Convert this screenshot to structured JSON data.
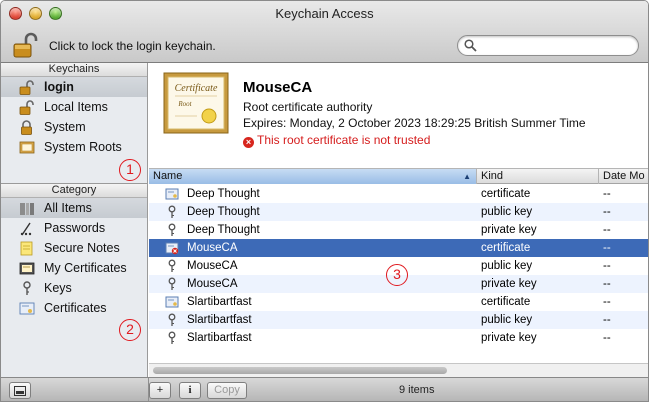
{
  "window": {
    "title": "Keychain Access"
  },
  "toolbar": {
    "lock_text": "Click to lock the login keychain.",
    "search_placeholder": ""
  },
  "sidebar": {
    "keychains_header": "Keychains",
    "keychains": [
      {
        "label": "login",
        "icon": "padlock-open-icon",
        "selected": true
      },
      {
        "label": "Local Items",
        "icon": "padlock-open-icon"
      },
      {
        "label": "System",
        "icon": "padlock-icon"
      },
      {
        "label": "System Roots",
        "icon": "folder-certificate-icon"
      }
    ],
    "category_header": "Category",
    "categories": [
      {
        "label": "All Items",
        "icon": "all-items-icon",
        "selected": true
      },
      {
        "label": "Passwords",
        "icon": "passwords-icon"
      },
      {
        "label": "Secure Notes",
        "icon": "secure-note-icon"
      },
      {
        "label": "My Certificates",
        "icon": "my-certificate-icon"
      },
      {
        "label": "Keys",
        "icon": "key-icon"
      },
      {
        "label": "Certificates",
        "icon": "certificate-icon"
      }
    ]
  },
  "detail": {
    "name": "MouseCA",
    "type": "Root certificate authority",
    "expires": "Expires: Monday, 2 October 2023 18:29:25 British Summer Time",
    "warning": "This root certificate is not trusted",
    "cert_image_text": "Certificate",
    "cert_image_sub": "Root"
  },
  "table": {
    "columns": {
      "name": "Name",
      "kind": "Kind",
      "date": "Date Mo"
    },
    "rows": [
      {
        "name": "Deep Thought",
        "kind": "certificate",
        "date": "--",
        "icon": "certificate-icon"
      },
      {
        "name": "Deep Thought",
        "kind": "public key",
        "date": "--",
        "icon": "key-icon"
      },
      {
        "name": "Deep Thought",
        "kind": "private key",
        "date": "--",
        "icon": "key-icon"
      },
      {
        "name": "MouseCA",
        "kind": "certificate",
        "date": "--",
        "icon": "untrusted-certificate-icon",
        "selected": true
      },
      {
        "name": "MouseCA",
        "kind": "public key",
        "date": "--",
        "icon": "key-icon"
      },
      {
        "name": "MouseCA",
        "kind": "private key",
        "date": "--",
        "icon": "key-icon"
      },
      {
        "name": "Slartibartfast",
        "kind": "certificate",
        "date": "--",
        "icon": "certificate-icon"
      },
      {
        "name": "Slartibartfast",
        "kind": "public key",
        "date": "--",
        "icon": "key-icon"
      },
      {
        "name": "Slartibartfast",
        "kind": "private key",
        "date": "--",
        "icon": "key-icon"
      }
    ]
  },
  "bottombar": {
    "copy_label": "Copy",
    "info_label": "i",
    "add_label": "+",
    "item_count": "9 items"
  },
  "callouts": [
    "1",
    "2",
    "3"
  ],
  "colors": {
    "selection": "#3d6ab7",
    "warning": "#d51c1c",
    "callout": "#e0191f"
  }
}
